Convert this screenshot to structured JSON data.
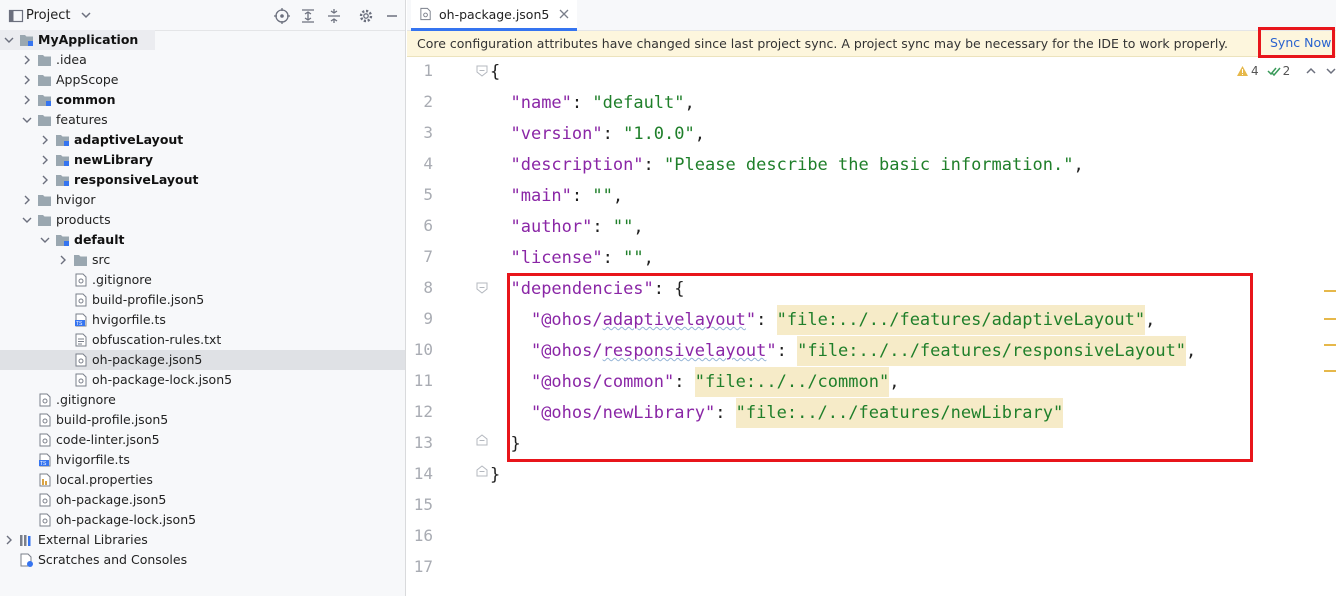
{
  "project_panel": {
    "title": "Project",
    "toolbar": [
      "locate-icon",
      "expand-all-icon",
      "collapse-all-icon",
      "gear-icon",
      "hide-icon"
    ],
    "tree": [
      {
        "label": "MyApplication",
        "icon": "module-folder-icon",
        "bold": true,
        "expanded": true,
        "selected_root": true
      },
      {
        "label": ".idea",
        "icon": "folder-icon",
        "expanded": false
      },
      {
        "label": "AppScope",
        "icon": "folder-icon",
        "expanded": false
      },
      {
        "label": "common",
        "icon": "module-folder-icon",
        "bold": true,
        "expanded": false
      },
      {
        "label": "features",
        "icon": "folder-icon",
        "expanded": true
      },
      {
        "label": "adaptiveLayout",
        "icon": "module-folder-icon",
        "bold": true,
        "expanded": false
      },
      {
        "label": "newLibrary",
        "icon": "module-folder-icon",
        "bold": true,
        "expanded": false
      },
      {
        "label": "responsiveLayout",
        "icon": "module-folder-icon",
        "bold": true,
        "expanded": false
      },
      {
        "label": "hvigor",
        "icon": "folder-icon",
        "expanded": false
      },
      {
        "label": "products",
        "icon": "folder-icon",
        "expanded": true
      },
      {
        "label": "default",
        "icon": "module-folder-icon",
        "bold": true,
        "expanded": true
      },
      {
        "label": "src",
        "icon": "folder-icon",
        "expanded": false
      },
      {
        "label": ".gitignore",
        "icon": "config-file-icon"
      },
      {
        "label": "build-profile.json5",
        "icon": "config-file-icon"
      },
      {
        "label": "hvigorfile.ts",
        "icon": "ts-file-icon"
      },
      {
        "label": "obfuscation-rules.txt",
        "icon": "text-file-icon"
      },
      {
        "label": "oh-package.json5",
        "icon": "config-file-icon",
        "selected": true
      },
      {
        "label": "oh-package-lock.json5",
        "icon": "config-file-icon"
      },
      {
        "label": ".gitignore",
        "icon": "config-file-icon"
      },
      {
        "label": "build-profile.json5",
        "icon": "config-file-icon"
      },
      {
        "label": "code-linter.json5",
        "icon": "config-file-icon"
      },
      {
        "label": "hvigorfile.ts",
        "icon": "ts-file-icon"
      },
      {
        "label": "local.properties",
        "icon": "properties-file-icon"
      },
      {
        "label": "oh-package.json5",
        "icon": "config-file-icon"
      },
      {
        "label": "oh-package-lock.json5",
        "icon": "config-file-icon"
      },
      {
        "label": "External Libraries",
        "icon": "libraries-icon",
        "expanded": false
      },
      {
        "label": "Scratches and Consoles",
        "icon": "scratches-icon"
      }
    ]
  },
  "editor": {
    "tab": {
      "label": "oh-package.json5",
      "icon": "config-file-icon",
      "close_icon": "close-icon"
    },
    "banner": {
      "message": "Core configuration attributes have changed since last project sync. A project sync may be necessary for the IDE to work properly.",
      "action": "Sync Now"
    },
    "inspections": {
      "warnings": "4",
      "weak_warnings": "2"
    },
    "line_numbers": [
      "1",
      "2",
      "3",
      "4",
      "5",
      "6",
      "7",
      "8",
      "9",
      "10",
      "11",
      "12",
      "13",
      "14",
      "15",
      "16",
      "17"
    ],
    "code": {
      "l1": "{",
      "l2_key": "\"name\"",
      "l2_val": "\"default\"",
      "l3_key": "\"version\"",
      "l3_val": "\"1.0.0\"",
      "l4_key": "\"description\"",
      "l4_val": "\"Please describe the basic information.\"",
      "l5_key": "\"main\"",
      "l5_val": "\"\"",
      "l6_key": "\"author\"",
      "l6_val": "\"\"",
      "l7_key": "\"license\"",
      "l7_val": "\"\"",
      "l8_key": "\"dependencies\"",
      "l8_rest": ": {",
      "l9_key_a": "\"@ohos/",
      "l9_key_b": "adaptivelayout",
      "l9_key_c": "\"",
      "l9_val": "\"file:../../features/adaptiveLayout\"",
      "l10_key_a": "\"@ohos/",
      "l10_key_b": "responsivelayout",
      "l10_key_c": "\"",
      "l10_val": "\"file:../../features/responsiveLayout\"",
      "l11_key": "\"@ohos/common\"",
      "l11_val": "\"file:../../common\"",
      "l12_key": "\"@ohos/newLibrary\"",
      "l12_val": "\"file:../../features/newLibrary\"",
      "l13": "}",
      "l14": "}"
    }
  },
  "colors": {
    "key": "#8a26a6",
    "string": "#1f7f2a",
    "highlight": "#f6ebc8",
    "annotation_box": "#e8151b",
    "link": "#2a63cf",
    "banner_bg": "#fdf6dd"
  }
}
